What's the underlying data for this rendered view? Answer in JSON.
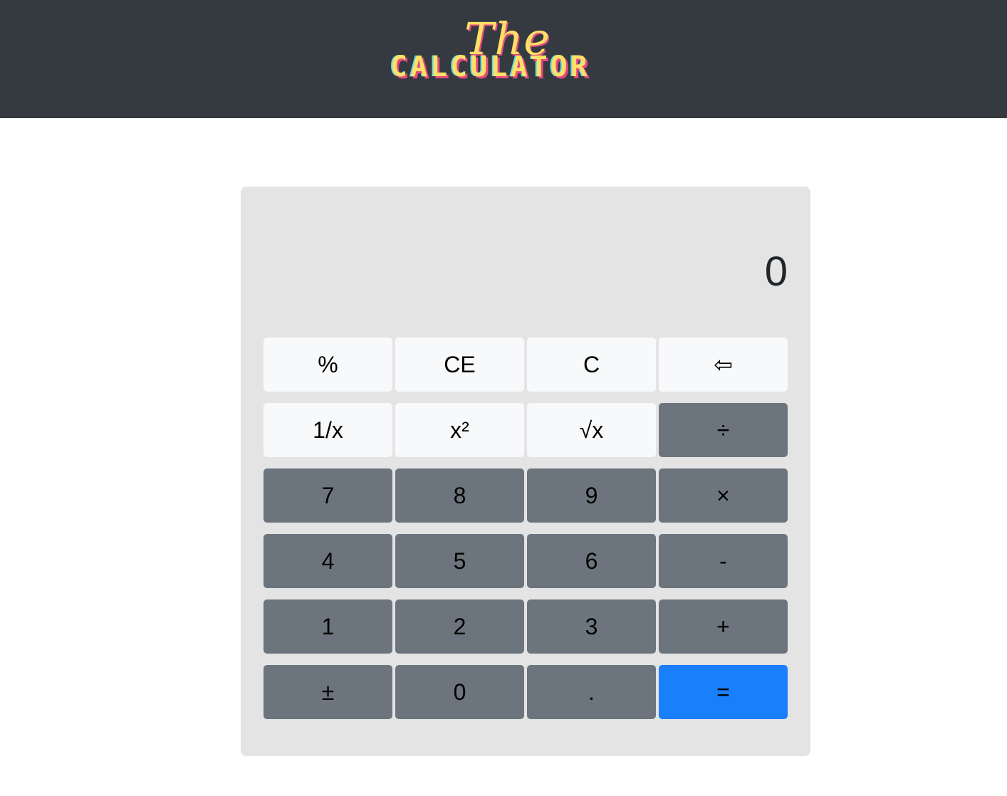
{
  "header": {
    "logo_script": "The",
    "logo_main": "CALCULATOR"
  },
  "display": {
    "value": "0"
  },
  "keys": [
    {
      "label": "%"
    },
    {
      "label": "CE"
    },
    {
      "label": "C"
    },
    {
      "label": "⇦"
    },
    {
      "label": "1/x"
    },
    {
      "label": "x²"
    },
    {
      "label": "√x"
    },
    {
      "label": "÷"
    },
    {
      "label": "7"
    },
    {
      "label": "8"
    },
    {
      "label": "9"
    },
    {
      "label": "×"
    },
    {
      "label": "4"
    },
    {
      "label": "5"
    },
    {
      "label": "6"
    },
    {
      "label": "-"
    },
    {
      "label": "1"
    },
    {
      "label": "2"
    },
    {
      "label": "3"
    },
    {
      "label": "+"
    },
    {
      "label": "±"
    },
    {
      "label": "0"
    },
    {
      "label": "."
    },
    {
      "label": "="
    }
  ],
  "colors": {
    "navbar": "#343a40",
    "panel": "#e4e4e4",
    "key_light": "#f8f9fa",
    "key_gray": "#6c757d",
    "key_equals": "#1a7ffb",
    "logo_yellow": "#ffe066",
    "logo_pink": "#e64980"
  }
}
